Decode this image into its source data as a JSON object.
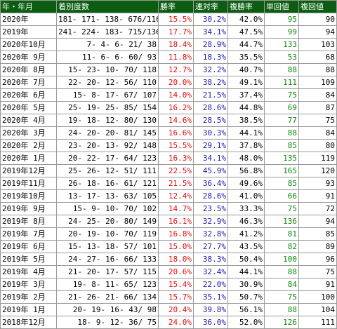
{
  "headers": [
    "年・年月",
    "着別度数",
    "勝率",
    "連対率",
    "複勝率",
    "単回値",
    "複回値"
  ],
  "rows": [
    {
      "period": "2020年",
      "counts": "181- 171- 138- 676/1166",
      "win": "15.5%",
      "ren": "30.2%",
      "fuku": "42.0%",
      "tan": "95",
      "fkv": "90"
    },
    {
      "period": "2019年",
      "counts": "241- 224- 183- 715/1363",
      "win": "17.7%",
      "ren": "34.1%",
      "fuku": "47.5%",
      "tan": "99",
      "fkv": "94"
    },
    {
      "period": "2020年10月",
      "counts": "7-   4-   6-   21/  38",
      "win": "18.4%",
      "ren": "28.9%",
      "fuku": "44.7%",
      "tan": "133",
      "fkv": "103"
    },
    {
      "period": "2020年 9月",
      "counts": "11-  6-   6-   60/  93",
      "win": "11.8%",
      "ren": "18.3%",
      "fuku": "35.5%",
      "tan": "53",
      "fkv": "68"
    },
    {
      "period": "2020年 8月",
      "counts": "15-  23-  10-  70/ 118",
      "win": "12.7%",
      "ren": "32.2%",
      "fuku": "40.7%",
      "tan": "88",
      "fkv": "88"
    },
    {
      "period": "2020年 7月",
      "counts": "22-  20-  12-  56/ 110",
      "win": "20.0%",
      "ren": "38.2%",
      "fuku": "49.1%",
      "tan": "111",
      "fkv": "109"
    },
    {
      "period": "2020年 6月",
      "counts": "15-  8-   17-  67/ 107",
      "win": "14.0%",
      "ren": "21.5%",
      "fuku": "37.4%",
      "tan": "75",
      "fkv": "84"
    },
    {
      "period": "2020年 5月",
      "counts": "25-  19-  25-  85/ 154",
      "win": "16.2%",
      "ren": "28.6%",
      "fuku": "44.8%",
      "tan": "69",
      "fkv": "87"
    },
    {
      "period": "2020年 4月",
      "counts": "19-  18-  12-  80/ 130",
      "win": "14.6%",
      "ren": "28.5%",
      "fuku": "38.5%",
      "tan": "77",
      "fkv": "75"
    },
    {
      "period": "2020年 3月",
      "counts": "24-  20-  20-  81/ 145",
      "win": "16.6%",
      "ren": "30.3%",
      "fuku": "44.1%",
      "tan": "88",
      "fkv": "84"
    },
    {
      "period": "2020年 2月",
      "counts": "23-  20-  13-  92/ 148",
      "win": "15.5%",
      "ren": "29.1%",
      "fuku": "37.8%",
      "tan": "85",
      "fkv": "80"
    },
    {
      "period": "2020年 1月",
      "counts": "20-  22-  17-  64/ 123",
      "win": "16.3%",
      "ren": "34.1%",
      "fuku": "48.0%",
      "tan": "135",
      "fkv": "119"
    },
    {
      "period": "2019年12月",
      "counts": "25-  26-  12-  51/ 111",
      "win": "22.5%",
      "ren": "45.9%",
      "fuku": "56.8%",
      "tan": "165",
      "fkv": "120"
    },
    {
      "period": "2019年11月",
      "counts": "26-  18-  16-  61/ 121",
      "win": "21.5%",
      "ren": "36.4%",
      "fuku": "49.6%",
      "tan": "85",
      "fkv": "93"
    },
    {
      "period": "2019年10月",
      "counts": "13-  17-  13-  63/ 105",
      "win": "12.4%",
      "ren": "28.6%",
      "fuku": "41.0%",
      "tan": "66",
      "fkv": "91"
    },
    {
      "period": "2019年 9月",
      "counts": "15-  9-   10-  70/ 102",
      "win": "14.7%",
      "ren": "23.5%",
      "fuku": "33.3%",
      "tan": "75",
      "fkv": "72"
    },
    {
      "period": "2019年 8月",
      "counts": "24-  25-  20-  80/ 149",
      "win": "16.1%",
      "ren": "32.9%",
      "fuku": "46.3%",
      "tan": "136",
      "fkv": "94"
    },
    {
      "period": "2019年 7月",
      "counts": "20-  19-  10-  70/ 119",
      "win": "16.8%",
      "ren": "32.8%",
      "fuku": "41.2%",
      "tan": "81",
      "fkv": "85"
    },
    {
      "period": "2019年 6月",
      "counts": "15-  13-  18-  57/ 101",
      "win": "15.0%",
      "ren": "27.7%",
      "fuku": "43.5%",
      "tan": "82",
      "fkv": "89"
    },
    {
      "period": "2019年 5月",
      "counts": "24-  27-  16-  66/ 133",
      "win": "18.0%",
      "ren": "38.3%",
      "fuku": "50.4%",
      "tan": "100",
      "fkv": "96"
    },
    {
      "period": "2019年 4月",
      "counts": "21-  20-  17-  57/ 115",
      "win": "20.6%",
      "ren": "32.4%",
      "fuku": "44.1%",
      "tan": "88",
      "fkv": "75"
    },
    {
      "period": "2019年 3月",
      "counts": "19-  8-   11-  65/ 123",
      "win": "15.4%",
      "ren": "22.0%",
      "fuku": "30.9%",
      "tan": "84",
      "fkv": "91"
    },
    {
      "period": "2019年 2月",
      "counts": "21-  26-  21-  66/ 134",
      "win": "15.7%",
      "ren": "35.1%",
      "fuku": "50.7%",
      "tan": "75",
      "fkv": "100"
    },
    {
      "period": "2019年 1月",
      "counts": "20-  19-  16-  43/  98",
      "win": "20.4%",
      "ren": "39.8%",
      "fuku": "56.1%",
      "tan": "88",
      "fkv": "104"
    },
    {
      "period": "2018年12月",
      "counts": "18-  9-   12-  36/  75",
      "win": "24.0%",
      "ren": "36.0%",
      "fuku": "52.0%",
      "tan": "126",
      "fkv": "111"
    }
  ]
}
